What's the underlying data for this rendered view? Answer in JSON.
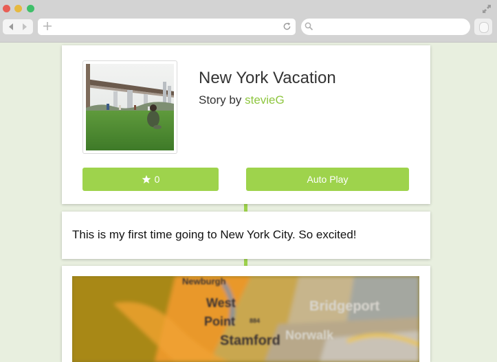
{
  "story": {
    "title": "New York Vacation",
    "byline_prefix": "Story by",
    "author": "stevieG",
    "star_count": "0",
    "autoplay_label": "Auto Play"
  },
  "entries": [
    {
      "type": "text",
      "text": "This is my first time going to New York City. So excited!"
    }
  ],
  "map_labels": [
    "Newburgh",
    "West",
    "Point",
    "Stamford",
    "Norwalk",
    "Bridgeport",
    "884"
  ],
  "colors": {
    "accent": "#9ed34c",
    "author_link": "#8ec63f",
    "background": "#e8efdf",
    "chrome": "#d3d3d3"
  },
  "icons": [
    "star-icon",
    "back-arrow-icon",
    "forward-arrow-icon",
    "plus-icon",
    "reload-icon",
    "search-icon",
    "fullscreen-icon"
  ]
}
